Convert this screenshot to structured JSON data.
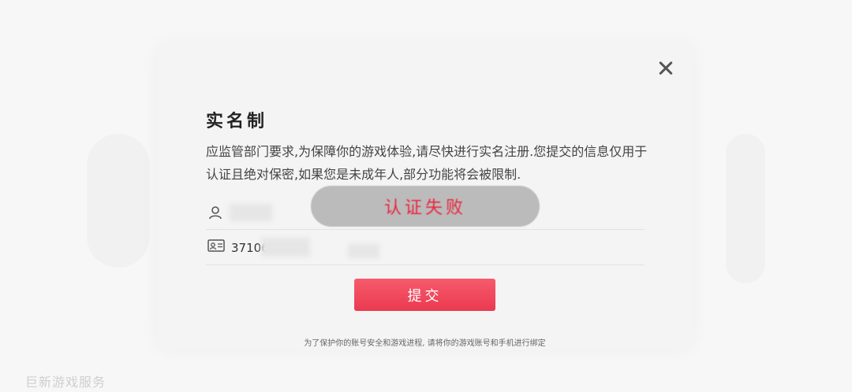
{
  "dialog": {
    "title": "实名制",
    "description": "应监管部门要求,为保障你的游戏体验,请尽快进行实名注册.您提交的信息仅用于认证且绝对保密,如果您是未成年人,部分功能将会被限制.",
    "name_field": {
      "value": ""
    },
    "id_field": {
      "value": "3710611090"
    },
    "submit_label": "提交",
    "footer_note": "为了保护你的账号安全和游戏进程, 请将你的游戏账号和手机进行绑定"
  },
  "toast": {
    "message": "认证失败"
  },
  "background": {
    "bottom_text": "巨新游戏服务"
  },
  "colors": {
    "accent": "#ea3a50",
    "toast_text": "#e8273f"
  },
  "icons": {
    "close": "close-icon",
    "user": "user-icon",
    "id_card": "id-card-icon"
  }
}
